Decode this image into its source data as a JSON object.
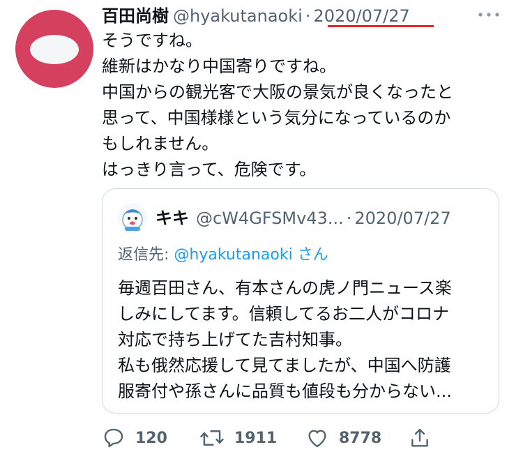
{
  "author": {
    "name": "百田尚樹",
    "handle": "@hyakutanaoki",
    "separator": "·",
    "date": "2020/07/27"
  },
  "tweet_lines": [
    "そうですね。",
    "維新はかなり中国寄りですね。",
    "中国からの観光客で大阪の景気が良くなったと",
    "思って、中国様様という気分になっているのか",
    "もしれません。",
    "はっきり言って、危険です。"
  ],
  "quoted": {
    "name": "キキ",
    "handle": "@cW4GFSMv43...",
    "separator": "·",
    "date": "2020/07/27",
    "reply_label": "返信先:",
    "reply_handle": "@hyakutanaoki",
    "reply_suffix": "さん",
    "lines": [
      "毎週百田さん、有本さんの虎ノ門ニュース楽",
      "しみにしてます。信頼してるお二人がコロナ",
      "対応で持ち上げてた吉村知事。",
      "私も俄然応援して見てましたが、中国へ防護",
      "服寄付や孫さんに品質も値段も分からない..."
    ]
  },
  "actions": {
    "reply_count": "120",
    "retweet_count": "1911",
    "like_count": "8778"
  },
  "icons": {
    "reply": "reply-icon",
    "retweet": "retweet-icon",
    "like": "heart-icon",
    "share": "share-icon",
    "more": "more-icon"
  },
  "colors": {
    "avatar": "#d6405f",
    "link": "#1d9bf0",
    "muted": "#536471",
    "underline": "#e0292b"
  }
}
